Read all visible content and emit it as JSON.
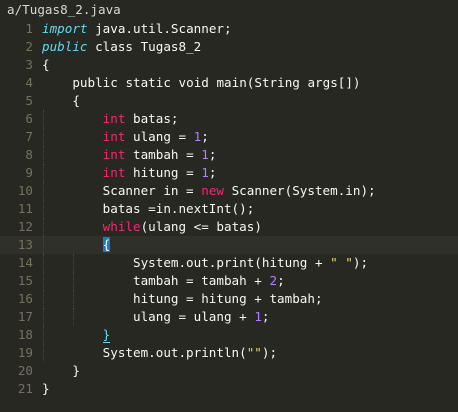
{
  "editor": {
    "tab_title": "a/Tugas8_2.java",
    "colors": {
      "background": "#272822",
      "keyword": "#f92672",
      "type": "#66d9ef",
      "number": "#ae81ff",
      "string": "#e6db74",
      "text": "#f8f8f2",
      "gutter": "#75715e",
      "bracket_highlight": "#1c79d0"
    },
    "active_line": 13,
    "lines": [
      {
        "num": "1",
        "tokens": [
          {
            "t": "import",
            "k": "type"
          },
          {
            "t": " java.util.Scanner;",
            "k": "plain"
          }
        ]
      },
      {
        "num": "2",
        "tokens": [
          {
            "t": "public",
            "k": "type"
          },
          {
            "t": " class Tugas8_2",
            "k": "plain"
          }
        ]
      },
      {
        "num": "3",
        "tokens": [
          {
            "t": "{",
            "k": "plain"
          }
        ]
      },
      {
        "num": "4",
        "tokens": [
          {
            "t": "    ",
            "k": "plain"
          },
          {
            "t": "public",
            "k": "plain"
          },
          {
            "t": " ",
            "k": "plain"
          },
          {
            "t": "static",
            "k": "plain"
          },
          {
            "t": " ",
            "k": "plain"
          },
          {
            "t": "void",
            "k": "plain"
          },
          {
            "t": " main(String args[])",
            "k": "plain"
          }
        ]
      },
      {
        "num": "5",
        "tokens": [
          {
            "t": "    {",
            "k": "plain"
          }
        ]
      },
      {
        "num": "6",
        "tokens": [
          {
            "t": "        ",
            "k": "plain"
          },
          {
            "t": "int",
            "k": "kw"
          },
          {
            "t": " batas;",
            "k": "plain"
          }
        ]
      },
      {
        "num": "7",
        "tokens": [
          {
            "t": "        ",
            "k": "plain"
          },
          {
            "t": "int",
            "k": "kw"
          },
          {
            "t": " ulang = ",
            "k": "plain"
          },
          {
            "t": "1",
            "k": "num"
          },
          {
            "t": ";",
            "k": "plain"
          }
        ]
      },
      {
        "num": "8",
        "tokens": [
          {
            "t": "        ",
            "k": "plain"
          },
          {
            "t": "int",
            "k": "kw"
          },
          {
            "t": " tambah = ",
            "k": "plain"
          },
          {
            "t": "1",
            "k": "num"
          },
          {
            "t": ";",
            "k": "plain"
          }
        ]
      },
      {
        "num": "9",
        "tokens": [
          {
            "t": "        ",
            "k": "plain"
          },
          {
            "t": "int",
            "k": "kw"
          },
          {
            "t": " hitung = ",
            "k": "plain"
          },
          {
            "t": "1",
            "k": "num"
          },
          {
            "t": ";",
            "k": "plain"
          }
        ]
      },
      {
        "num": "10",
        "tokens": [
          {
            "t": "        Scanner in = ",
            "k": "plain"
          },
          {
            "t": "new",
            "k": "kw"
          },
          {
            "t": " Scanner(System.in);",
            "k": "plain"
          }
        ]
      },
      {
        "num": "11",
        "tokens": [
          {
            "t": "        batas =in.nextInt();",
            "k": "plain"
          }
        ]
      },
      {
        "num": "12",
        "tokens": [
          {
            "t": "        ",
            "k": "plain"
          },
          {
            "t": "while",
            "k": "kw"
          },
          {
            "t": "(ulang <= batas)",
            "k": "plain"
          }
        ]
      },
      {
        "num": "13",
        "tokens": [
          {
            "t": "        ",
            "k": "plain"
          },
          {
            "t": "{",
            "k": "brace-hl"
          }
        ]
      },
      {
        "num": "14",
        "tokens": [
          {
            "t": "            System.out.print(hitung + ",
            "k": "plain"
          },
          {
            "t": "\" \"",
            "k": "str"
          },
          {
            "t": ");",
            "k": "plain"
          }
        ]
      },
      {
        "num": "15",
        "tokens": [
          {
            "t": "            tambah = tambah + ",
            "k": "plain"
          },
          {
            "t": "2",
            "k": "num"
          },
          {
            "t": ";",
            "k": "plain"
          }
        ]
      },
      {
        "num": "16",
        "tokens": [
          {
            "t": "            hitung = hitung + tambah;",
            "k": "plain"
          }
        ]
      },
      {
        "num": "17",
        "tokens": [
          {
            "t": "            ulang = ulang + ",
            "k": "plain"
          },
          {
            "t": "1",
            "k": "num"
          },
          {
            "t": ";",
            "k": "plain"
          }
        ]
      },
      {
        "num": "18",
        "tokens": [
          {
            "t": "        ",
            "k": "plain"
          },
          {
            "t": "}",
            "k": "brace-under"
          }
        ]
      },
      {
        "num": "19",
        "tokens": [
          {
            "t": "        System.out.println(",
            "k": "plain"
          },
          {
            "t": "\"\"",
            "k": "str"
          },
          {
            "t": ");",
            "k": "plain"
          }
        ]
      },
      {
        "num": "20",
        "tokens": [
          {
            "t": "    }",
            "k": "plain"
          }
        ]
      },
      {
        "num": "21",
        "tokens": [
          {
            "t": "}",
            "k": "plain"
          }
        ]
      }
    ]
  }
}
